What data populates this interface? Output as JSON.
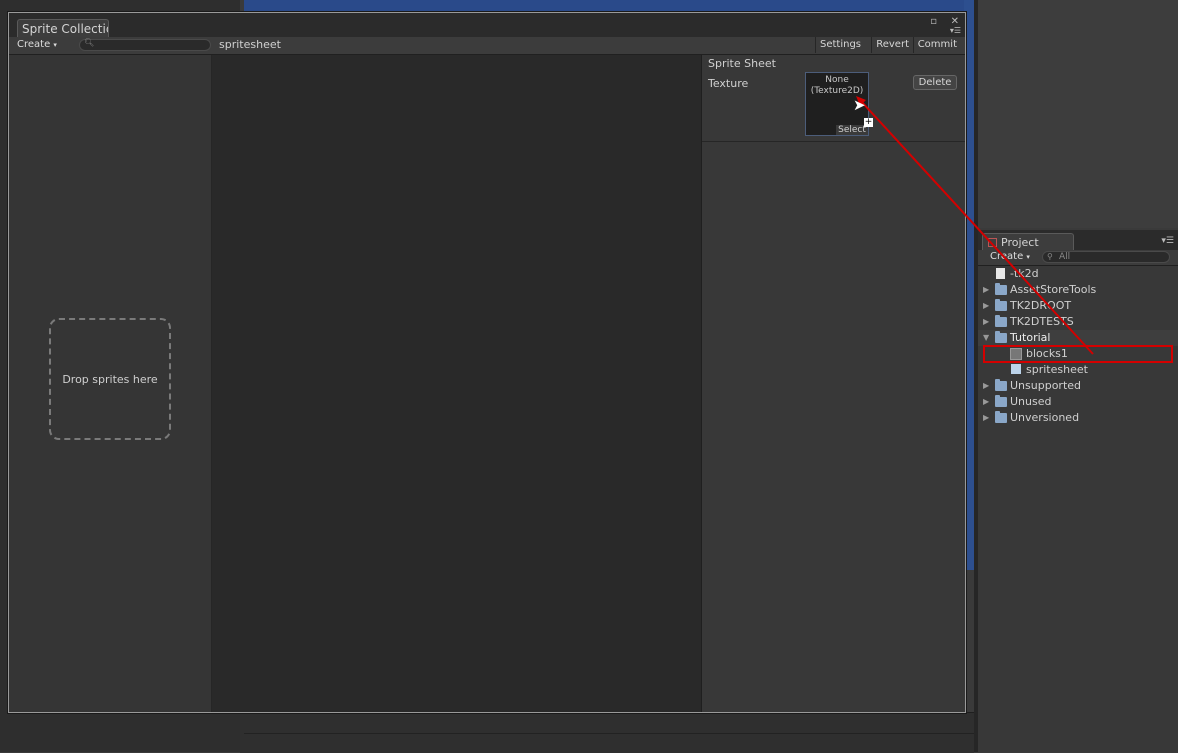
{
  "window": {
    "tab_title": "Sprite Collectic",
    "toolbar": {
      "create_label": "Create",
      "collection_name": "spritesheet",
      "settings_label": "Settings",
      "revert_label": "Revert",
      "commit_label": "Commit"
    },
    "left_pane": {
      "drop_text": "Drop sprites here"
    },
    "right_pane": {
      "header": "Sprite Sheet",
      "texture_label": "Texture",
      "texture_value": "None (Texture2D)",
      "select_label": "Select",
      "delete_label": "Delete"
    }
  },
  "project": {
    "tab_title": "Project",
    "create_label": "Create",
    "search_placeholder": "All",
    "items": [
      {
        "label": "-tk2d",
        "type": "file",
        "expanded": false
      },
      {
        "label": "AssetStoreTools",
        "type": "folder",
        "expanded": false
      },
      {
        "label": "TK2DROOT",
        "type": "folder",
        "expanded": false
      },
      {
        "label": "TK2DTESTS",
        "type": "folder",
        "expanded": false
      },
      {
        "label": "Tutorial",
        "type": "folder",
        "expanded": true
      },
      {
        "label": "blocks1",
        "type": "texture",
        "highlighted": true
      },
      {
        "label": "spritesheet",
        "type": "prefab"
      },
      {
        "label": "Unsupported",
        "type": "folder",
        "expanded": false
      },
      {
        "label": "Unused",
        "type": "folder",
        "expanded": false
      },
      {
        "label": "Unversioned",
        "type": "folder",
        "expanded": false
      }
    ]
  },
  "annotation": {
    "color": "#d40000"
  }
}
